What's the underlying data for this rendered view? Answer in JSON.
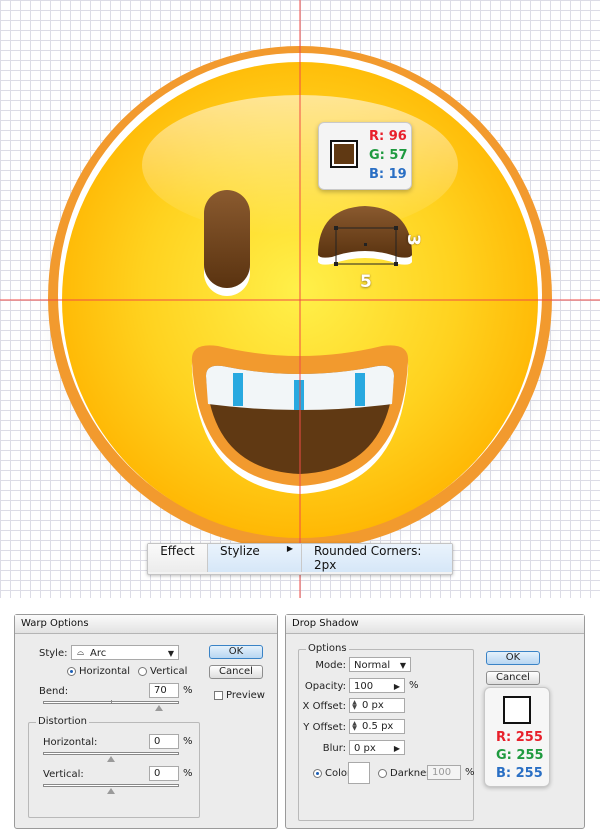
{
  "canvas": {
    "eye_color_badge": {
      "r": "R: 96",
      "g": "G: 57",
      "b": "B: 19",
      "swatch_color": "#603913"
    },
    "dimension_width": "5",
    "dimension_height": "3",
    "guide_color": "#f04b45",
    "menu": {
      "effect": "Effect",
      "stylize": "Stylize",
      "rounded_corners": "Rounded Corners: 2px"
    }
  },
  "colors": {
    "face_yellow": "#ffd21f",
    "face_rim": "#f29a2e",
    "eye_brown": "#603913",
    "teeth_blue": "#29a9e0",
    "red_text": "#e8202b",
    "green_text": "#1f9a3f",
    "blue_text": "#2a6fc4"
  },
  "warp_options": {
    "title": "Warp Options",
    "style_label": "Style:",
    "style_value": "Arc",
    "horizontal_label": "Horizontal",
    "vertical_label": "Vertical",
    "bend_label": "Bend:",
    "bend_value": "70",
    "percent": "%",
    "distortion_label": "Distortion",
    "dist_horizontal_label": "Horizontal:",
    "dist_horizontal_value": "0",
    "dist_vertical_label": "Vertical:",
    "dist_vertical_value": "0",
    "ok": "OK",
    "cancel": "Cancel",
    "preview_label": "Preview",
    "bend_level": 0.85,
    "dist_horizontal_level": 0.5,
    "dist_vertical_level": 0.5
  },
  "drop_shadow": {
    "title": "Drop Shadow",
    "options_label": "Options",
    "mode_label": "Mode:",
    "mode_value": "Normal",
    "opacity_label": "Opacity:",
    "opacity_value": "100",
    "percent": "%",
    "x_offset_label": "X Offset:",
    "x_offset_value": "0 px",
    "y_offset_label": "Y Offset:",
    "y_offset_value": "0.5 px",
    "blur_label": "Blur:",
    "blur_value": "0 px",
    "color_label": "Color:",
    "darkness_label": "Darkness:",
    "darkness_value": "100",
    "ok": "OK",
    "cancel": "Cancel",
    "color_badge": {
      "r": "R: 255",
      "g": "G: 255",
      "b": "B: 255",
      "swatch_color": "#ffffff"
    }
  }
}
